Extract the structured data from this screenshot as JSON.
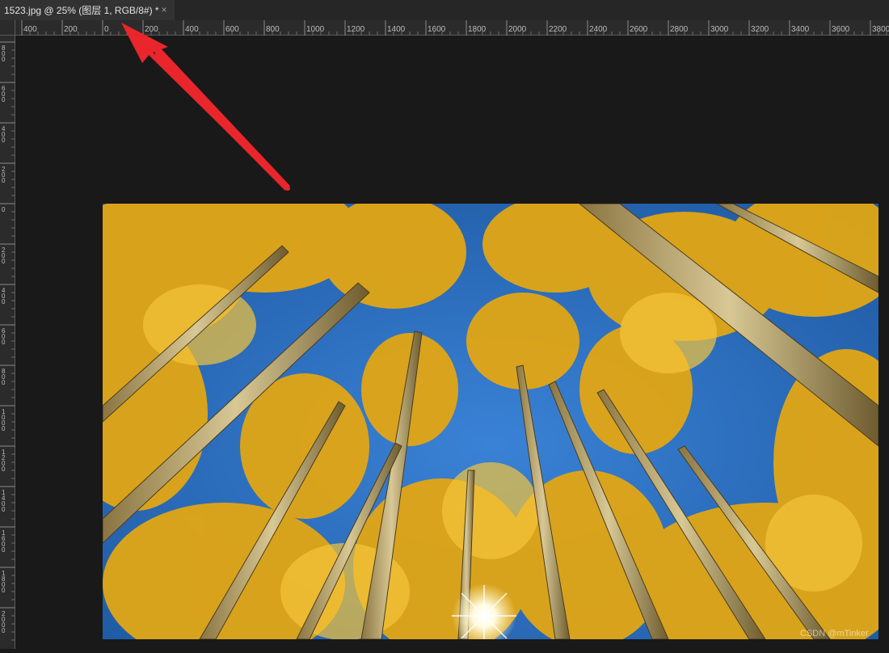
{
  "document_tab": {
    "title": "1523.jpg @ 25% (图层 1, RGB/8#) *",
    "close_glyph": "×"
  },
  "ruler_top_labels": [
    "400",
    "200",
    "0",
    "200",
    "400",
    "600",
    "800",
    "1000",
    "1200",
    "1400",
    "1600",
    "1800",
    "2000",
    "2200",
    "2400",
    "2600",
    "2800",
    "3000",
    "3200",
    "3400",
    "3600",
    "3800"
  ],
  "ruler_left_labels": [
    "800",
    "600",
    "400",
    "200",
    "0",
    "200",
    "400",
    "600",
    "800",
    "1000",
    "1200",
    "1400",
    "1600",
    "1800",
    "2000"
  ],
  "canvas": {
    "image_description_icon": "photo-aspen-trees",
    "watermark": "CSDN @mTinker"
  },
  "colors": {
    "arrow": "#e8262b",
    "workspace": "#191919",
    "sky": "#2a6fc0",
    "foliage": "#e0a818"
  }
}
